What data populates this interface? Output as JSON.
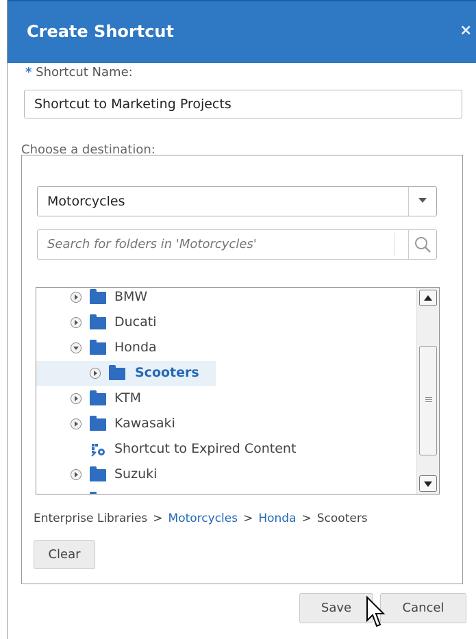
{
  "dialog": {
    "title": "Create Shortcut",
    "close_glyph": "×",
    "title_bar_color": "#2f78c4"
  },
  "form": {
    "required_mark": "*",
    "name_label": "Shortcut Name:",
    "name_value": "Shortcut to Marketing Projects",
    "destination_label": "Choose a destination:"
  },
  "destination": {
    "library_selected": "Motorcycles",
    "search_placeholder": "Search for folders in 'Motorcycles'"
  },
  "tree": {
    "items": [
      {
        "label": "BMW",
        "type": "folder",
        "expanded": false,
        "level": 0
      },
      {
        "label": "Ducati",
        "type": "folder",
        "expanded": false,
        "level": 0
      },
      {
        "label": "Honda",
        "type": "folder",
        "expanded": true,
        "level": 0
      },
      {
        "label": "Scooters",
        "type": "folder",
        "expanded": false,
        "level": 1,
        "selected": true
      },
      {
        "label": "KTM",
        "type": "folder",
        "expanded": false,
        "level": 0
      },
      {
        "label": "Kawasaki",
        "type": "folder",
        "expanded": false,
        "level": 0
      },
      {
        "label": "Shortcut to Expired Content",
        "type": "shortcut",
        "level": 0
      },
      {
        "label": "Suzuki",
        "type": "folder",
        "expanded": false,
        "level": 0
      }
    ]
  },
  "breadcrumb": {
    "root": "Enterprise Libraries",
    "separator": ">",
    "links": [
      "Motorcycles",
      "Honda"
    ],
    "current": "Scooters"
  },
  "buttons": {
    "clear": "Clear",
    "save": "Save",
    "cancel": "Cancel"
  }
}
